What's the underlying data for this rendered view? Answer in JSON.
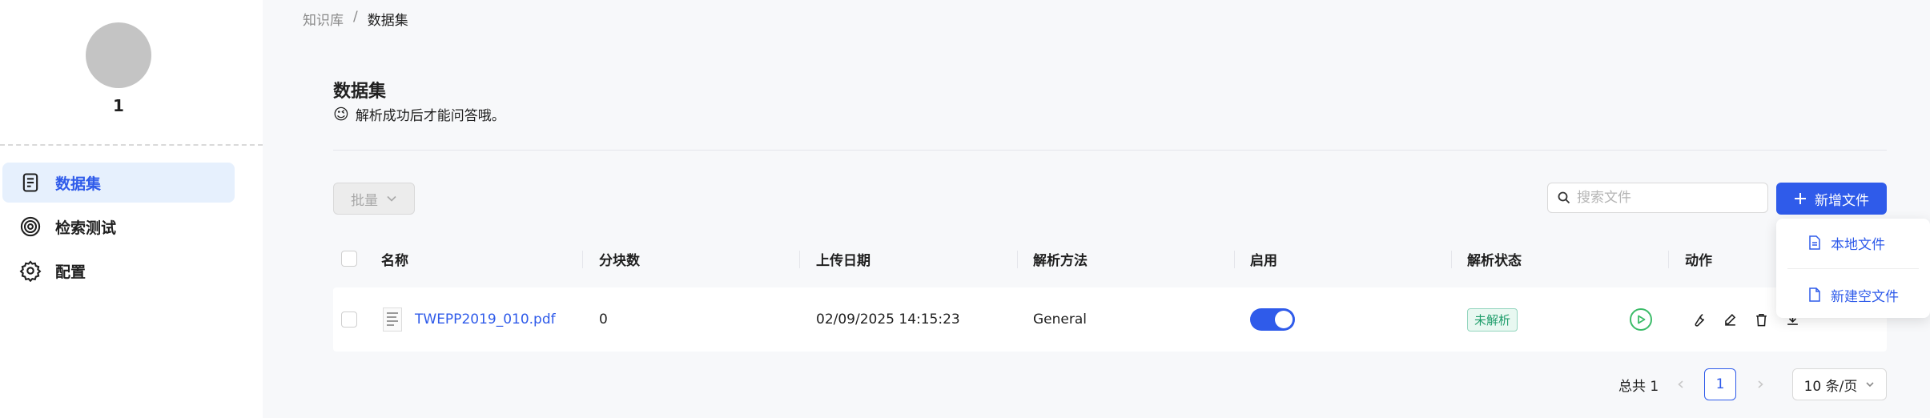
{
  "sidebar": {
    "kb_name": "1",
    "items": [
      {
        "label": "数据集",
        "icon": "document-icon",
        "active": true
      },
      {
        "label": "检索测试",
        "icon": "target-icon",
        "active": false
      },
      {
        "label": "配置",
        "icon": "gear-icon",
        "active": false
      }
    ]
  },
  "breadcrumb": {
    "parent": "知识库",
    "separator": "/",
    "current": "数据集"
  },
  "header": {
    "title": "数据集",
    "subtitle": "解析成功后才能问答哦。",
    "subtitle_emoji": "😉"
  },
  "toolbar": {
    "batch_label": "批量",
    "search_placeholder": "搜索文件",
    "add_file_label": "新增文件"
  },
  "dropdown": {
    "items": [
      {
        "label": "本地文件",
        "icon": "file-icon"
      },
      {
        "label": "新建空文件",
        "icon": "file-blank-icon"
      }
    ]
  },
  "table": {
    "columns": [
      "名称",
      "分块数",
      "上传日期",
      "解析方法",
      "启用",
      "解析状态",
      "动作"
    ],
    "rows": [
      {
        "name": "TWEPP2019_010.pdf",
        "chunks": "0",
        "upload_date": "02/09/2025 14:15:23",
        "parse_method": "General",
        "enabled": true,
        "status": "未解析"
      }
    ]
  },
  "pagination": {
    "total_label": "总共 1",
    "current_page": "1",
    "page_size": "10 条/页"
  },
  "colors": {
    "accent": "#2f5bea",
    "success": "#3cbc69",
    "status_bg": "#e8f8f1"
  }
}
